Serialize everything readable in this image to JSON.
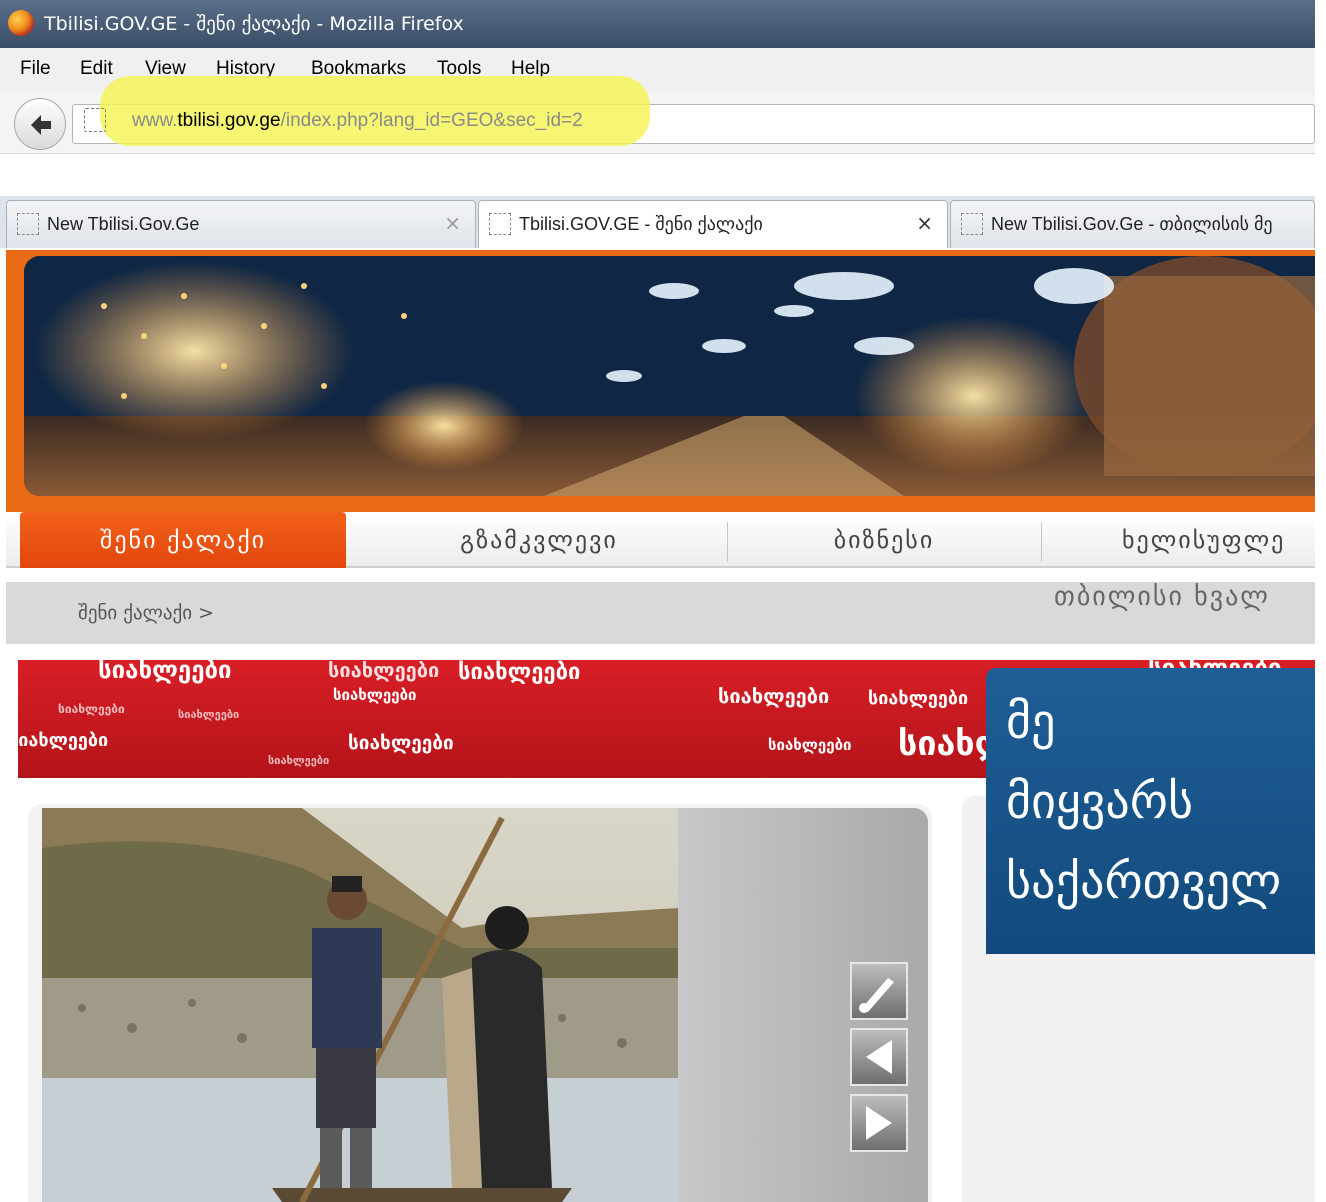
{
  "window": {
    "title": "Tbilisi.GOV.GE - შენი ქალაქი - Mozilla Firefox"
  },
  "menu": [
    "File",
    "Edit",
    "View",
    "History",
    "Bookmarks",
    "Tools",
    "Help"
  ],
  "address": {
    "prefix": "www.",
    "domain": "tbilisi.gov.ge",
    "path": "/index.php?lang_id=GEO&sec_id=2",
    "highlight_color": "#f4f45a"
  },
  "tabs": [
    {
      "label": "New Tbilisi.Gov.Ge",
      "close": "×"
    },
    {
      "label": "Tbilisi.GOV.GE - შენი ქალაქი",
      "close": "×"
    },
    {
      "label": "New Tbilisi.Gov.Ge - თბილისის მე"
    }
  ],
  "site_nav": [
    {
      "label": "შენი ქალაქი",
      "active": true
    },
    {
      "label": "გზამკვლევი",
      "active": false
    },
    {
      "label": "ბიზნესი",
      "active": false
    },
    {
      "label": "ხელისუფლე",
      "active": false
    }
  ],
  "breadcrumb": "შენი ქალაქი >",
  "news_band": {
    "word": "სიახლეები",
    "color": "#c8171e"
  },
  "right_panel": {
    "title": "თბილისი ხვალ",
    "promo_lines": [
      "მე",
      "მიყვარს",
      "საქართველ"
    ]
  },
  "colors": {
    "accent": "#e8521a",
    "brand_blue": "#1a5a90"
  }
}
